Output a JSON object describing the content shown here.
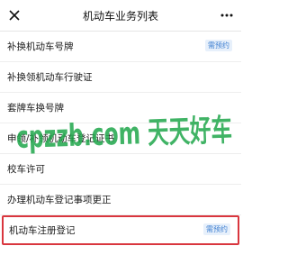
{
  "header": {
    "title": "机动车业务列表",
    "close_icon": "close-icon",
    "more_icon": "more-icon"
  },
  "tag_color": "#3e7fd1",
  "highlight_color": "#d9363e",
  "items": [
    {
      "label": "补换机动车号牌",
      "tag": "需预约"
    },
    {
      "label": "补换领机动车行驶证",
      "tag": ""
    },
    {
      "label": "套牌车换号牌",
      "tag": ""
    },
    {
      "label": "申领/补领机动车登记证书",
      "tag": ""
    },
    {
      "label": "校车许可",
      "tag": ""
    },
    {
      "label": "办理机动车登记事项更正",
      "tag": ""
    },
    {
      "label": "机动车注册登记",
      "tag": "需预约"
    }
  ],
  "watermark": {
    "text": "cpzzb.com 天天好车",
    "color": "#1fa64a"
  }
}
